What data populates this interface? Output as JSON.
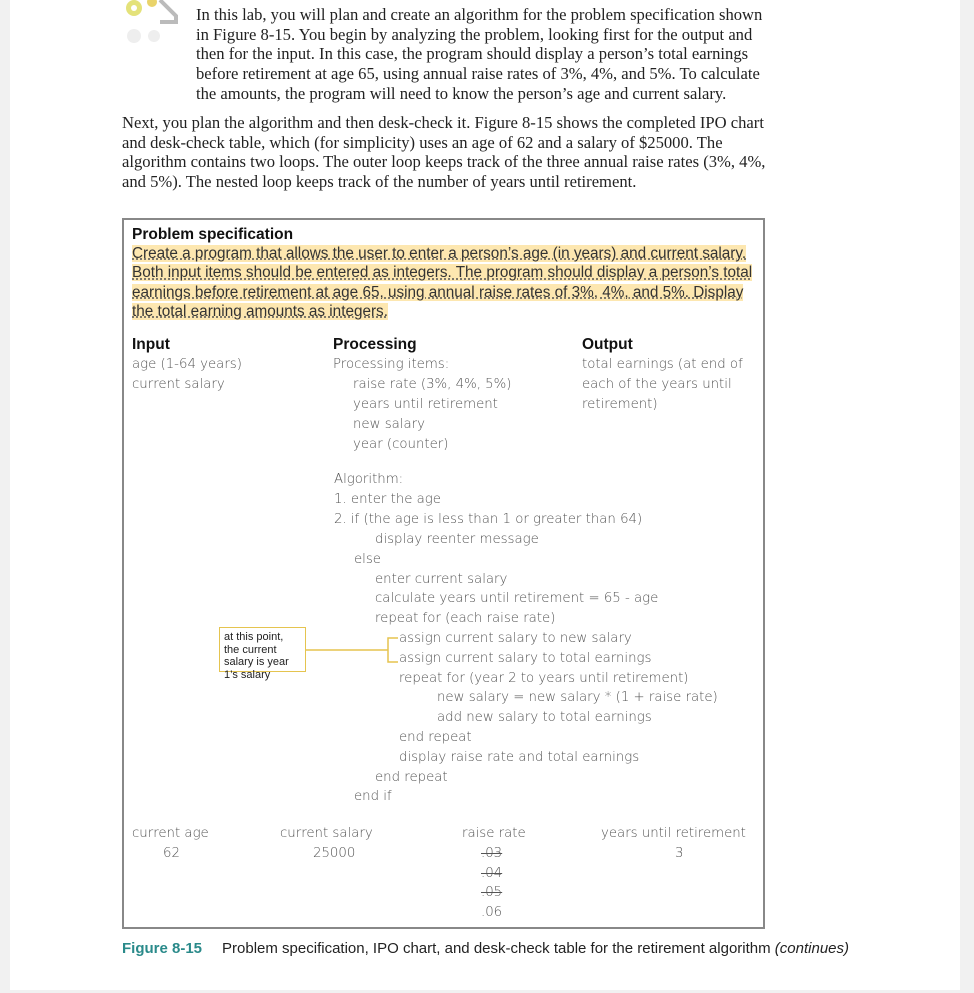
{
  "intro": {
    "p1": "In this lab, you will plan and create an algorithm for the problem specification shown in Figure 8-15. You begin by analyzing the problem, looking first for the output and then for the input. In this case, the program should display a person’s total earnings before retirement at age 65, using annual raise rates of 3%, 4%, and 5%. To calculate the amounts, the program will need to know the person’s age and current salary.",
    "p2": "Next, you plan the algorithm and then desk-check it. Figure 8-15 shows the completed IPO chart and desk-check table, which (for simplicity) uses an age of 62 and a salary of $25000. The algorithm contains two loops. The outer loop keeps track of the three annual raise rates (3%, 4%, and 5%). The nested loop keeps track of the number of years until retirement."
  },
  "figure": {
    "spec_heading": "Problem specification",
    "spec_text": "Create a program that allows the user to enter a person’s age (in years) and current salary. Both input items should be entered as integers. The program should display a person’s total earnings before retirement at age 65, using annual raise rates of 3%, 4%, and 5%. Display the total earning amounts as integers.",
    "input_heading": "Input",
    "input_items": [
      "age (1-64 years)",
      "current salary"
    ],
    "processing_heading": "Processing",
    "processing_items": [
      "Processing items:",
      "raise rate (3%, 4%, 5%)",
      "years until retirement",
      "new salary",
      "year (counter)"
    ],
    "output_heading": "Output",
    "output_items": [
      "total earnings (at end of",
      "each of the years until",
      "retirement)"
    ],
    "algorithm": [
      "Algorithm:",
      "1.  enter the age",
      "2.  if (the age is less than 1 or greater than 64)",
      "display reenter message",
      "else",
      "enter current salary",
      "calculate years until retirement = 65 - age",
      "repeat for (each raise rate)",
      "assign current salary to new salary",
      "assign current salary to total earnings",
      "repeat for (year 2 to years until retirement)",
      "new salary = new salary * (1 + raise rate)",
      "add new salary to total earnings",
      "end repeat",
      "display raise rate and total earnings",
      "end repeat",
      "end if"
    ],
    "note": "at this point, the current salary is year 1’s salary",
    "desk_check": {
      "headers": [
        "current age",
        "current salary",
        "raise rate",
        "years until retirement"
      ],
      "current_age": "62",
      "current_salary": "25000",
      "raise_rates": [
        ".03",
        ".04",
        ".05",
        ".06"
      ],
      "years": "3"
    },
    "caption_label": "Figure 8-15",
    "caption_text": "Problem specification, IPO chart, and desk-check table for the retirement algorithm",
    "caption_continues": "(continues)"
  }
}
